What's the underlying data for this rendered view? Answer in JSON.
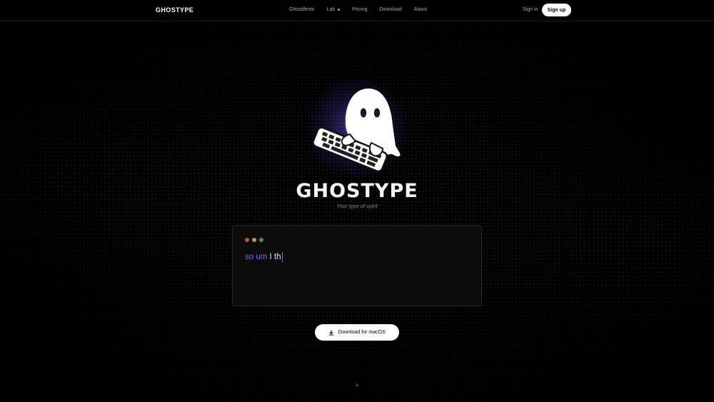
{
  "nav": {
    "logo": "GHOSTYPE",
    "links": [
      "Ghostifesto",
      "Lab",
      "Pricing",
      "Download",
      "About"
    ],
    "sign_in": "Sign in",
    "sign_up": "Sign up"
  },
  "hero": {
    "title": "GHOSTYPE",
    "tagline": "Your type of spirit",
    "illustration": "ghost-typing-keyboard"
  },
  "typing_demo": {
    "filler_text": "so um",
    "typed_text": "I th"
  },
  "download": {
    "label": "Download for macOS",
    "icon": "download-icon"
  },
  "colors": {
    "background": "#000000",
    "accent": "#8b5cf6",
    "lab_dot": "#2fd2e8",
    "traffic_red": "#c44d45",
    "traffic_yellow": "#c49a2e",
    "traffic_green": "#3f9a45"
  }
}
